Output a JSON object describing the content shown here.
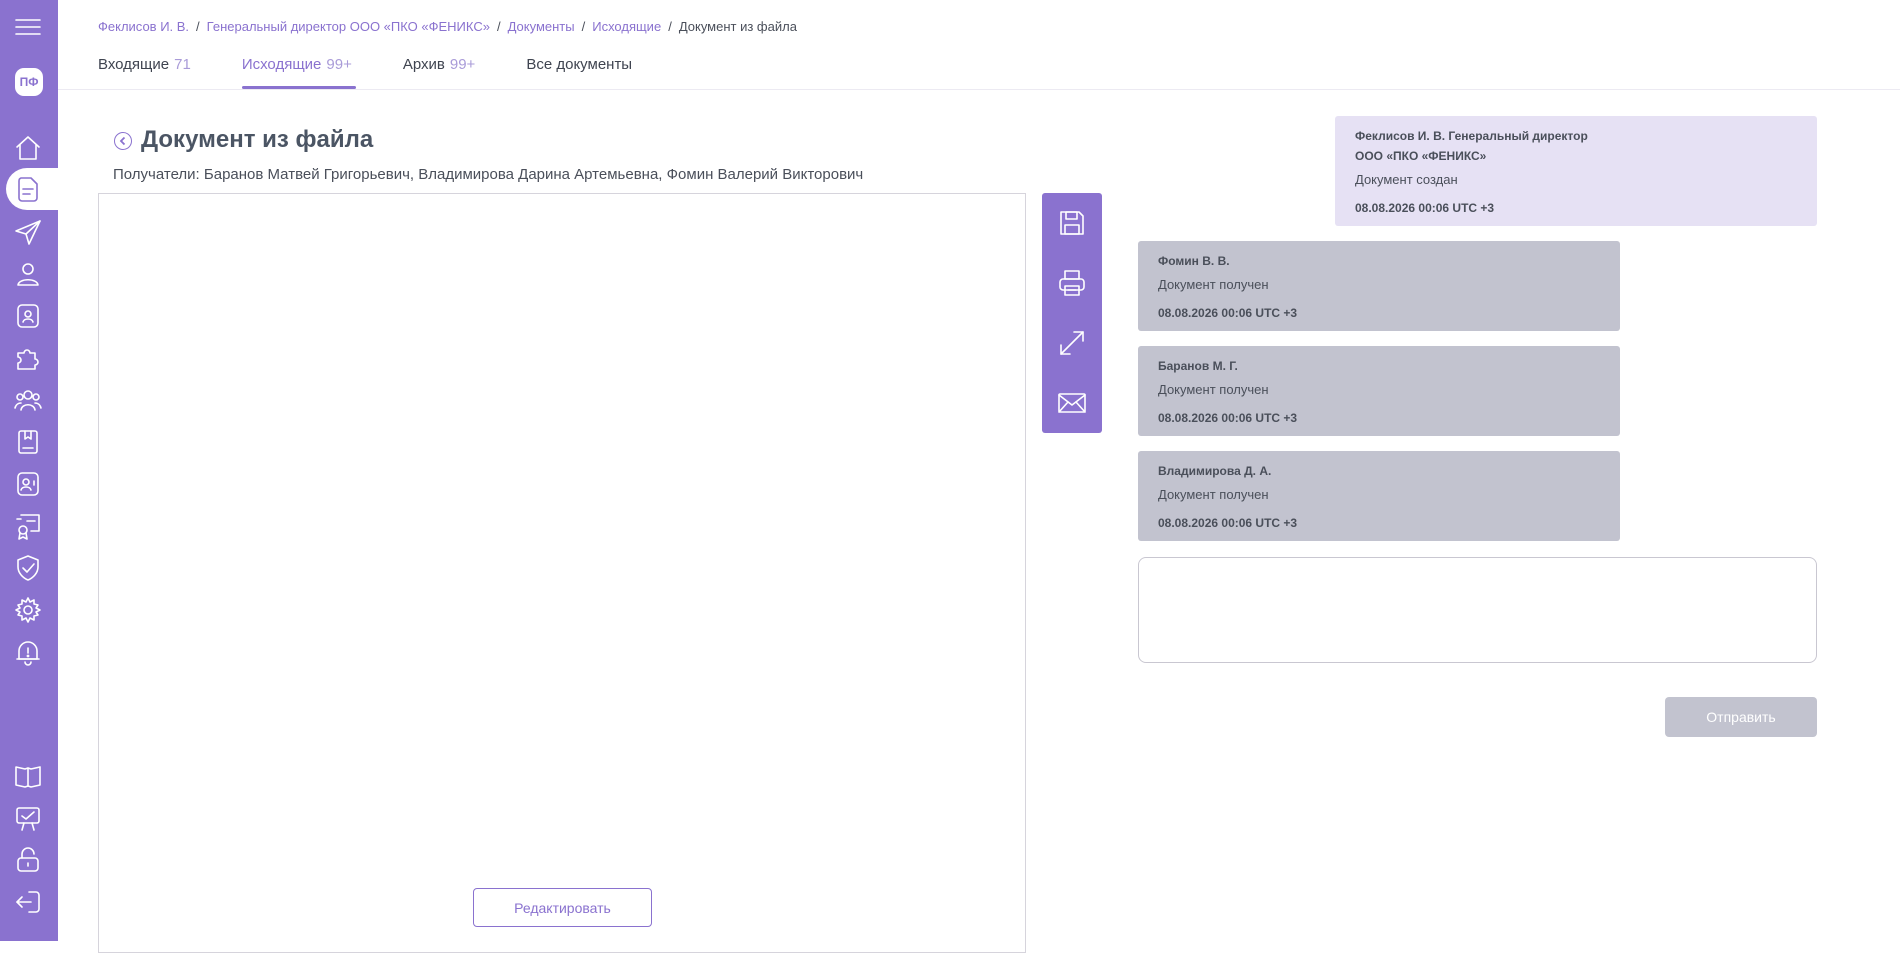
{
  "sidebar": {
    "avatar_initials": "ПФ",
    "icons": [
      "menu-icon",
      "home-icon",
      "documents-icon",
      "send-icon",
      "user-icon",
      "badge-icon",
      "puzzle-icon",
      "group-icon",
      "book-icon",
      "contact-icon",
      "certificate-icon",
      "shield-icon",
      "settings-icon",
      "bell-icon",
      "guide-icon",
      "support-icon",
      "lock-icon",
      "logout-icon"
    ],
    "active_item": "documents-icon",
    "accent_color": "#8a72cf"
  },
  "breadcrumb": [
    "Феклисов И. В.",
    "Генеральный директор ООО «ПКО «ФЕНИКС»",
    "Документы",
    "Исходящие",
    "Документ из файла"
  ],
  "tabs": [
    {
      "label": "Входящие",
      "count": "71",
      "active": false
    },
    {
      "label": "Исходящие",
      "count": "99+",
      "active": true
    },
    {
      "label": "Архив",
      "count": "99+",
      "active": false
    },
    {
      "label": "Все документы",
      "count": "",
      "active": false
    }
  ],
  "document": {
    "title": "Документ из файла",
    "recipients": "Получатели: Баранов Матвей Григорьевич, Владимирова Дарина Артемьевна, Фомин Валерий Викторович",
    "edit_label": "Редактировать"
  },
  "toolbar": [
    "save-icon",
    "print-icon",
    "expand-icon",
    "mail-icon"
  ],
  "history": [
    {
      "name": "Феклисов И. В. Генеральный директор",
      "name2": "ООО «ПКО «ФЕНИКС»",
      "status": "Документ создан",
      "time": "08.08.2026 00:06 UTC +3",
      "own": true
    },
    {
      "name": "Фомин В. В.",
      "status": "Документ получен",
      "time": "08.08.2026 00:06 UTC +3",
      "own": false
    },
    {
      "name": "Баранов М. Г.",
      "status": "Документ получен",
      "time": "08.08.2026 00:06 UTC +3",
      "own": false
    },
    {
      "name": "Владимирова Д. А.",
      "status": "Документ получен",
      "time": "08.08.2026 00:06 UTC +3",
      "own": false
    }
  ],
  "comment": {
    "value": "",
    "placeholder": ""
  },
  "send_label": "Отправить"
}
